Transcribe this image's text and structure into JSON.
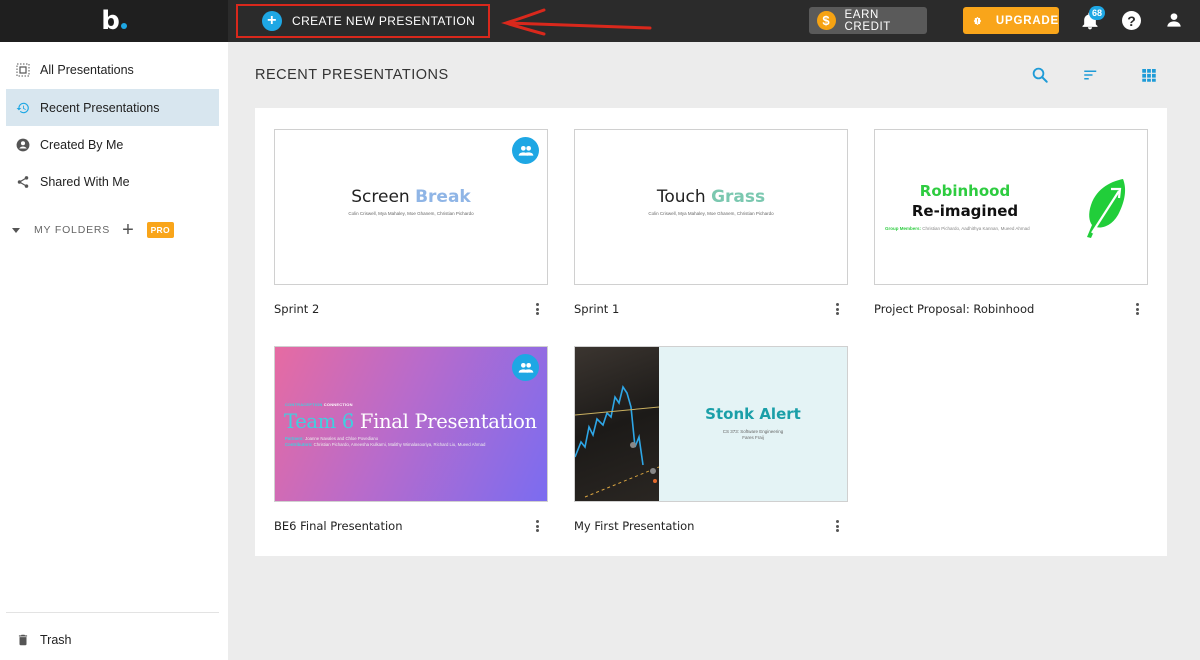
{
  "topbar": {
    "logo": "b",
    "create_label": "CREATE NEW PRESENTATION",
    "earn_label": "EARN CREDIT",
    "earn_icon": "dollar-icon",
    "upgrade_label": "UPGRADE",
    "upgrade_icon": "badge-alert-icon",
    "notification_count": "68",
    "help_glyph": "?"
  },
  "sidebar": {
    "items": [
      {
        "label": "All Presentations",
        "icon": "all-presentations-icon",
        "active": false
      },
      {
        "label": "Recent Presentations",
        "icon": "history-icon",
        "active": true
      },
      {
        "label": "Created By Me",
        "icon": "user-circle-icon",
        "active": false
      },
      {
        "label": "Shared With Me",
        "icon": "share-icon",
        "active": false
      }
    ],
    "folders_label": "MY FOLDERS",
    "add_folder_glyph": "+",
    "pro_badge": "PRO",
    "trash_label": "Trash"
  },
  "main": {
    "title": "RECENT PRESENTATIONS",
    "tools": [
      "search-icon",
      "sort-icon",
      "grid-view-icon"
    ]
  },
  "presentations": [
    {
      "title": "Sprint 2",
      "shared": true,
      "slide": {
        "word1": "Screen",
        "word2": "Break",
        "subtitle": "Colin Criswell, Mya Mahaley, Moe Ghanem, Christian Pichardo"
      }
    },
    {
      "title": "Sprint 1",
      "shared": false,
      "slide": {
        "word1": "Touch",
        "word2": "Grass",
        "subtitle": "Colin Criswell, Mya Mahaley, Moe Ghanem, Christian Pichardo"
      }
    },
    {
      "title": "Project Proposal: Robinhood",
      "shared": false,
      "slide": {
        "line1": "Robinhood",
        "line2": "Re-imagined",
        "members_label": "Group Members:",
        "members": " Christian Pichardo, Aadhithya Kannan, Mueed Ahmad"
      }
    },
    {
      "title": "BE6 Final Presentation",
      "shared": true,
      "slide": {
        "kicker_a": "CONTRACEPTION",
        "kicker_b": " CONNECTION",
        "title_a": "Team 6",
        "title_b": " Final Presentation",
        "partners_label": "Partners:",
        "partners": " Joanne Navales and Chloe Povediano",
        "contributors_label": "Contributors:",
        "contributors": " Christian Pichardo, Ameesha Kulkarni, Malithy Wimalasooriya, Richard Liu, Mueed Ahmad"
      }
    },
    {
      "title": "My First Presentation",
      "shared": false,
      "slide": {
        "title": "Stonk Alert",
        "line1": "CS 373: Software Engineering",
        "line2": "Fares Fraij"
      }
    }
  ],
  "colors": {
    "accent": "#1ea7e4",
    "upgrade": "#f9a51a",
    "annotation": "#d9281c",
    "active_nav": "#d8e6ef"
  }
}
